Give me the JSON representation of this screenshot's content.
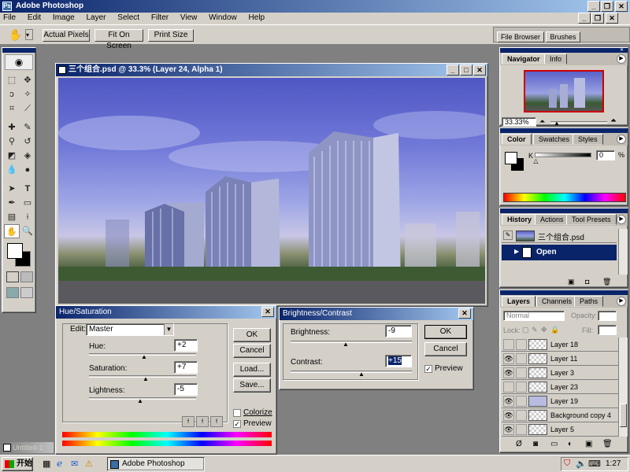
{
  "app": {
    "title": "Adobe Photoshop"
  },
  "menu": [
    "File",
    "Edit",
    "Image",
    "Layer",
    "Select",
    "Filter",
    "View",
    "Window",
    "Help"
  ],
  "options_bar": {
    "buttons": [
      "Actual Pixels",
      "Fit On Screen",
      "Print Size"
    ],
    "well_tabs": [
      "File Browser",
      "Brushes"
    ]
  },
  "document": {
    "title": "三个组合.psd @ 33.3% (Layer 24, Alpha 1)",
    "minimized_title": "Untitled-1"
  },
  "navigator": {
    "tabs": [
      "Navigator",
      "Info"
    ],
    "zoom": "33.33%"
  },
  "color_panel": {
    "tabs": [
      "Color",
      "Swatches",
      "Styles"
    ],
    "channel_label": "K",
    "value": "0",
    "unit": "%"
  },
  "history": {
    "tabs": [
      "History",
      "Actions",
      "Tool Presets"
    ],
    "snapshot": "三个组合.psd",
    "state": "Open"
  },
  "layers": {
    "tabs": [
      "Layers",
      "Channels",
      "Paths"
    ],
    "blend_mode": "Normal",
    "opacity_label": "Opacity:",
    "fill_label": "Fill:",
    "lock_label": "Lock:",
    "items": [
      {
        "name": "Layer 18",
        "visible": false
      },
      {
        "name": "Layer 11",
        "visible": true
      },
      {
        "name": "Layer 3",
        "visible": true
      },
      {
        "name": "Layer 23",
        "visible": false
      },
      {
        "name": "Layer 19",
        "visible": true
      },
      {
        "name": "Background copy 4",
        "visible": true
      },
      {
        "name": "Layer 5",
        "visible": true
      }
    ]
  },
  "hue_sat": {
    "title": "Hue/Saturation",
    "edit_label": "Edit:",
    "edit_value": "Master",
    "hue_label": "Hue:",
    "hue_value": "+2",
    "sat_label": "Saturation:",
    "sat_value": "+7",
    "light_label": "Lightness:",
    "light_value": "-5",
    "ok": "OK",
    "cancel": "Cancel",
    "load": "Load...",
    "save": "Save...",
    "colorize": "Colorize",
    "preview": "Preview"
  },
  "bright_contrast": {
    "title": "Brightness/Contrast",
    "brightness_label": "Brightness:",
    "brightness_value": "-9",
    "contrast_label": "Contrast:",
    "contrast_value": "+15",
    "ok": "OK",
    "cancel": "Cancel",
    "preview": "Preview"
  },
  "taskbar": {
    "start": "开始",
    "task": "Adobe Photoshop",
    "clock": "1:27"
  },
  "colors": {
    "title_start": "#0a246a",
    "title_end": "#a6caf0",
    "face": "#d4d0c8",
    "desktop": "#3a6ea5"
  }
}
